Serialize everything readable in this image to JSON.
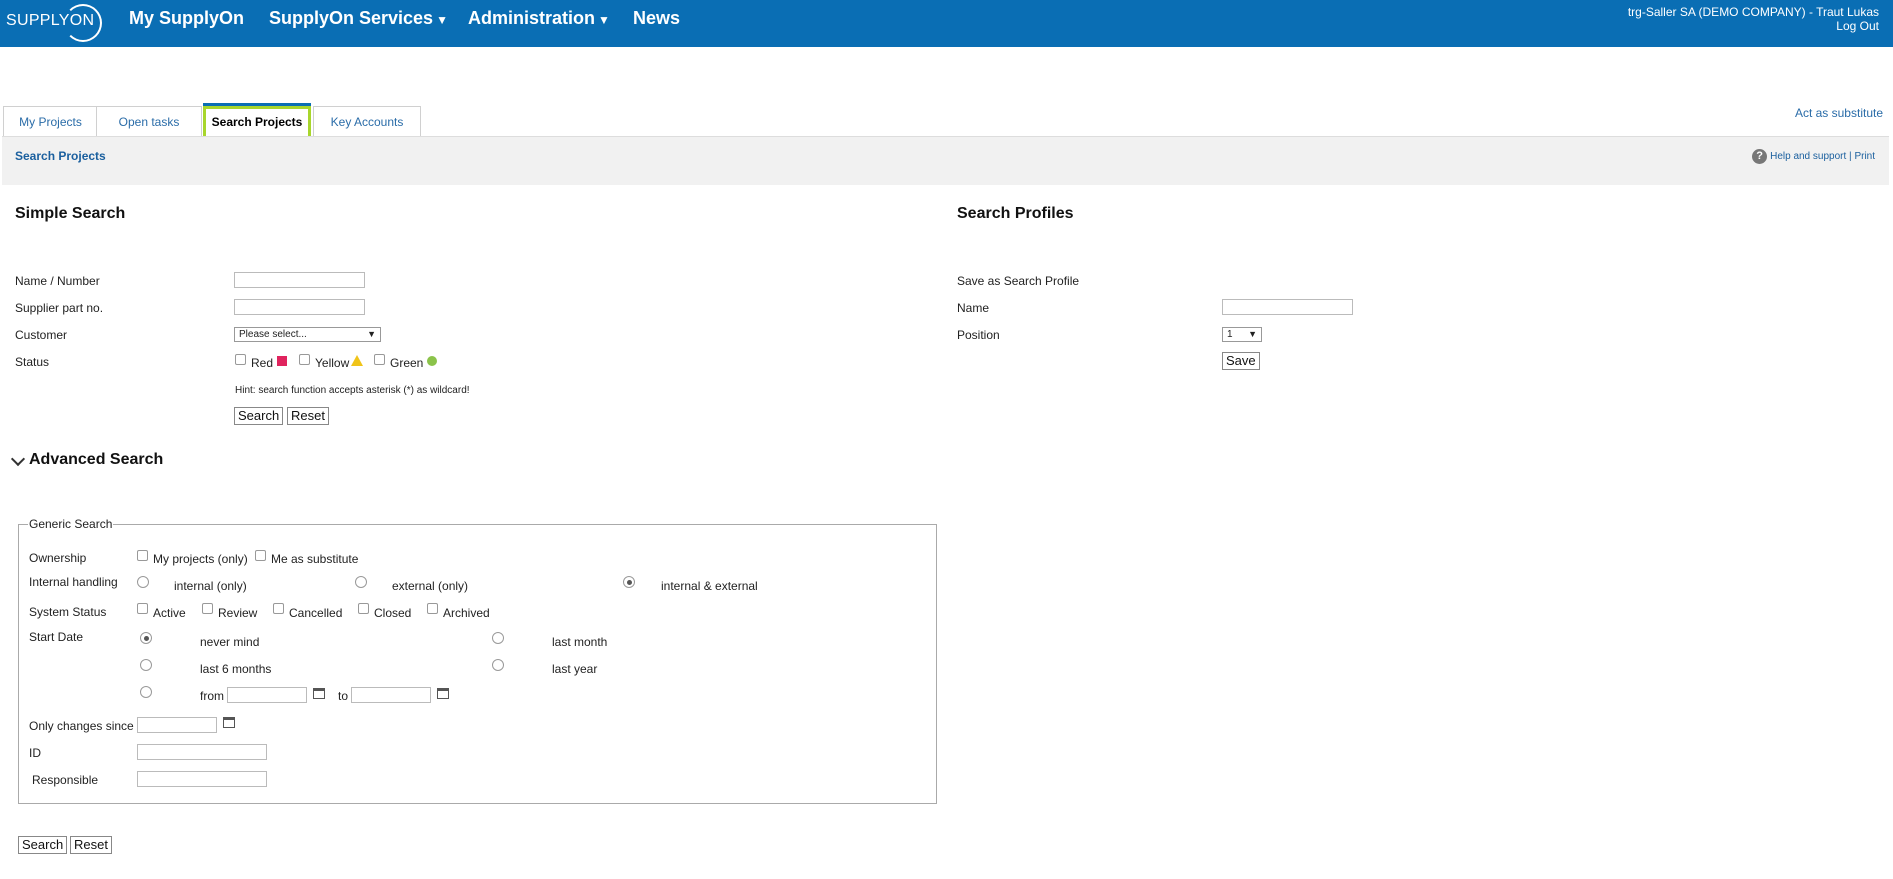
{
  "topbar": {
    "logo": "SUPPLYON",
    "nav": [
      "My SupplyOn",
      "SupplyOn Services",
      "Administration",
      "News"
    ],
    "user": "trg-Saller SA (DEMO COMPANY) - Traut Lukas",
    "logout": "Log Out"
  },
  "tabs": [
    "My Projects",
    "Open tasks",
    "Search Projects",
    "Key Accounts"
  ],
  "act_as_substitute": "Act as substitute",
  "subheader": {
    "title": "Search Projects",
    "help": "Help and support",
    "sep": "|",
    "print": "Print"
  },
  "simple": {
    "heading": "Simple Search",
    "name_label": "Name / Number",
    "supplier_label": "Supplier part no.",
    "customer_label": "Customer",
    "customer_value": "Please select...",
    "status_label": "Status",
    "red": "Red",
    "yellow": "Yellow",
    "green": "Green",
    "hint": "Hint: search function accepts asterisk (*) as wildcard!",
    "search_btn": "Search",
    "reset_btn": "Reset"
  },
  "profiles": {
    "heading": "Search Profiles",
    "save_as": "Save as Search Profile",
    "name_label": "Name",
    "position_label": "Position",
    "position_value": "1",
    "save_btn": "Save"
  },
  "advanced": {
    "heading": "Advanced Search",
    "legend": "Generic Search",
    "ownership_label": "Ownership",
    "my_projects": "My projects (only)",
    "me_substitute": "Me as substitute",
    "internal_label": "Internal handling",
    "internal_only": "internal (only)",
    "external_only": "external (only)",
    "internal_external": "internal & external",
    "system_status_label": "System Status",
    "active": "Active",
    "review": "Review",
    "cancelled": "Cancelled",
    "closed": "Closed",
    "archived": "Archived",
    "start_date_label": "Start Date",
    "never_mind": "never mind",
    "last_month": "last month",
    "last_6_months": "last 6 months",
    "last_year": "last year",
    "from": "from",
    "to": "to",
    "only_changes_label": "Only changes since",
    "id_label": "ID",
    "responsible_label": "Responsible",
    "search_btn": "Search",
    "reset_btn": "Reset"
  }
}
